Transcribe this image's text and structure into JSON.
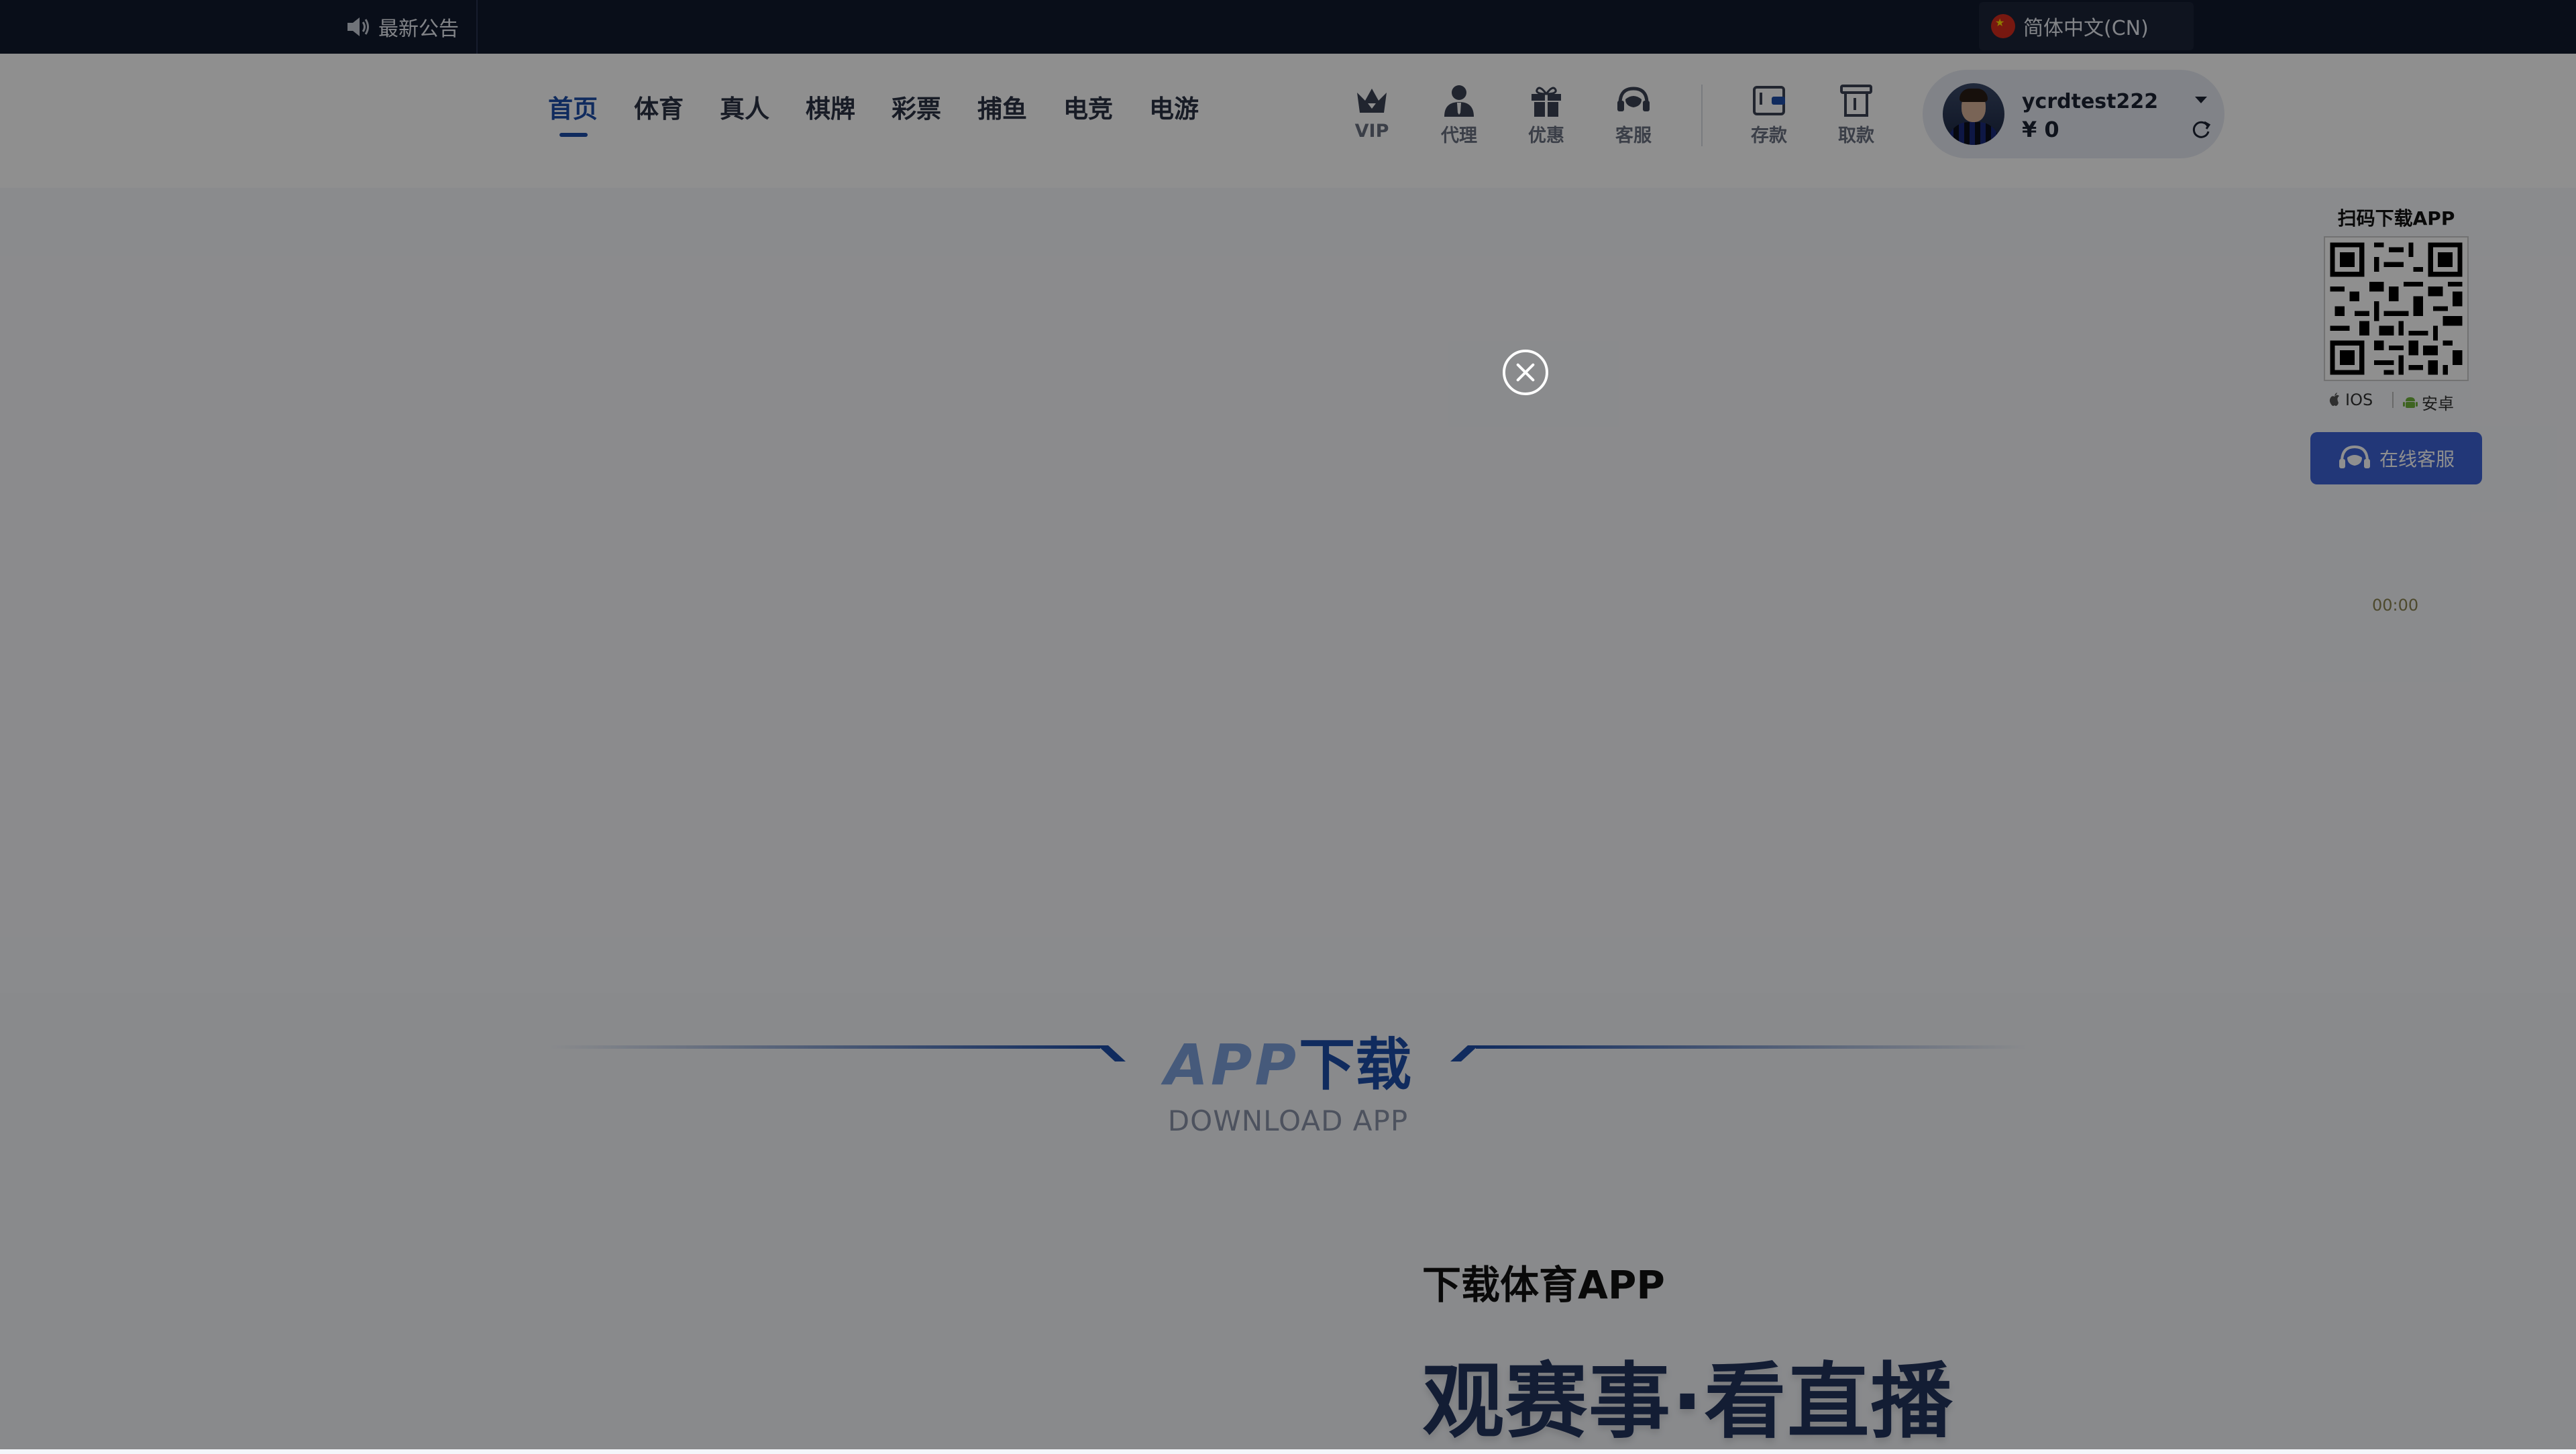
{
  "topbar": {
    "notice_label": "最新公告",
    "notice_icon": "speaker-icon",
    "language_label": "简体中文(CN)",
    "language_flag": "china-flag-icon"
  },
  "nav": {
    "items": [
      {
        "label": "首页",
        "active": true
      },
      {
        "label": "体育",
        "active": false
      },
      {
        "label": "真人",
        "active": false
      },
      {
        "label": "棋牌",
        "active": false
      },
      {
        "label": "彩票",
        "active": false
      },
      {
        "label": "捕鱼",
        "active": false
      },
      {
        "label": "电竞",
        "active": false
      },
      {
        "label": "电游",
        "active": false
      }
    ],
    "active_color": "#1e4ea8"
  },
  "actions": {
    "items": [
      {
        "label": "VIP",
        "icon": "crown-icon"
      },
      {
        "label": "代理",
        "icon": "agent-icon"
      },
      {
        "label": "优惠",
        "icon": "gift-icon"
      },
      {
        "label": "客服",
        "icon": "headset-icon"
      },
      {
        "label": "存款",
        "icon": "wallet-icon"
      },
      {
        "label": "取款",
        "icon": "withdraw-icon"
      }
    ]
  },
  "user": {
    "username": "ycrdtest222",
    "balance": "¥ 0"
  },
  "section": {
    "title_app": "APP",
    "title_rest": "下载",
    "subtitle": "DOWNLOAD APP",
    "download_title": "下载体育APP",
    "slogan": "观赛事·看直播"
  },
  "float_panel": {
    "qr_title": "扫码下载APP",
    "ios_label": "IOS",
    "android_label": "安卓",
    "cs_label": "在线客服",
    "timer": "00:00"
  },
  "colors": {
    "topbar_bg": "#111a2e",
    "accent": "#1e4ea8",
    "cs_button": "#3d63d6",
    "overlay": "rgba(0,0,0,0.44)"
  }
}
